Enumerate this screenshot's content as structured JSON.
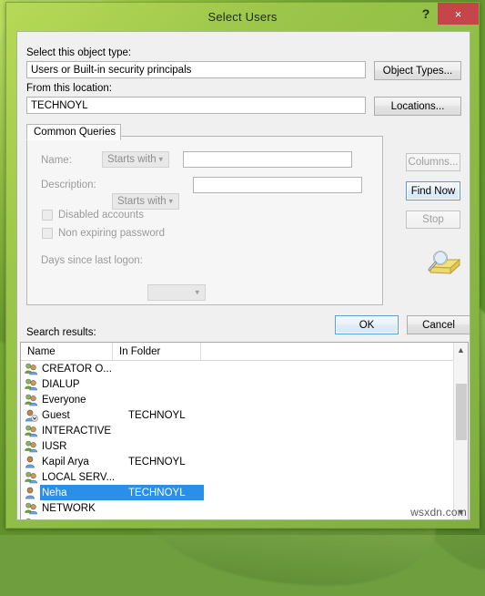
{
  "window": {
    "title": "Select Users",
    "help_label": "?",
    "close_label": "×"
  },
  "object_type": {
    "label": "Select this object type:",
    "value": "Users or Built-in security principals",
    "button": "Object Types..."
  },
  "location": {
    "label": "From this location:",
    "value": "TECHNOYL",
    "button": "Locations..."
  },
  "common_queries": {
    "tab_label": "Common Queries",
    "name_label": "Name:",
    "name_operator": "Starts with",
    "name_value": "",
    "description_label": "Description:",
    "description_operator": "Starts with",
    "description_value": "",
    "disabled_accounts_label": "Disabled accounts",
    "disabled_accounts_checked": false,
    "non_expiring_label": "Non expiring password",
    "non_expiring_checked": false,
    "days_label": "Days since last logon:",
    "days_value": ""
  },
  "side_buttons": {
    "columns": "Columns...",
    "find_now": "Find Now",
    "stop": "Stop"
  },
  "dialog_buttons": {
    "ok": "OK",
    "cancel": "Cancel"
  },
  "results": {
    "label": "Search results:",
    "columns": [
      "Name",
      "In Folder"
    ],
    "rows": [
      {
        "name": "CREATOR O...",
        "folder": "",
        "icon": "group-icon",
        "selected": false
      },
      {
        "name": "DIALUP",
        "folder": "",
        "icon": "group-icon",
        "selected": false
      },
      {
        "name": "Everyone",
        "folder": "",
        "icon": "group-icon",
        "selected": false
      },
      {
        "name": "Guest",
        "folder": "TECHNOYL",
        "icon": "user-disabled-icon",
        "selected": false
      },
      {
        "name": "INTERACTIVE",
        "folder": "",
        "icon": "group-icon",
        "selected": false
      },
      {
        "name": "IUSR",
        "folder": "",
        "icon": "group-icon",
        "selected": false
      },
      {
        "name": "Kapil Arya",
        "folder": "TECHNOYL",
        "icon": "user-icon",
        "selected": false
      },
      {
        "name": "LOCAL SERV...",
        "folder": "",
        "icon": "group-icon",
        "selected": false
      },
      {
        "name": "Neha",
        "folder": "TECHNOYL",
        "icon": "user-icon",
        "selected": true
      },
      {
        "name": "NETWORK",
        "folder": "",
        "icon": "group-icon",
        "selected": false
      },
      {
        "name": "",
        "folder": "",
        "icon": "group-icon",
        "selected": false
      }
    ]
  },
  "watermark": "wsxdn.com",
  "colors": {
    "titlebar_green": "#9cc64a",
    "close_red": "#c4454a",
    "selection_blue": "#2a8fe8",
    "default_button_border": "#5a9fd4"
  }
}
